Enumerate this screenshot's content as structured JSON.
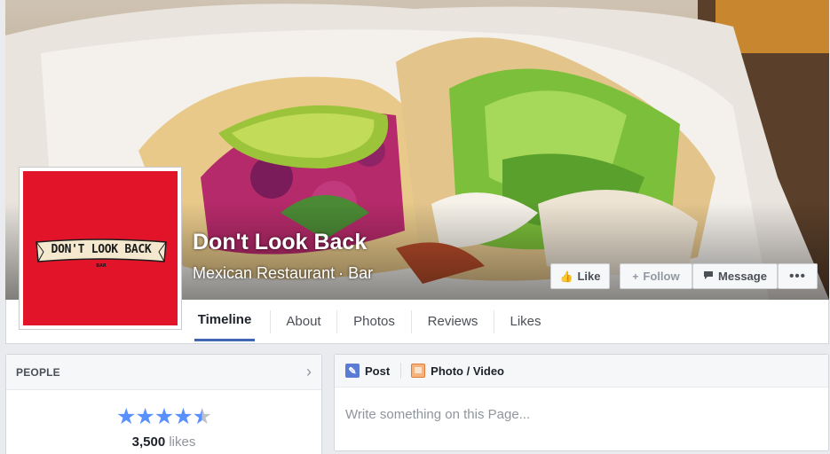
{
  "page": {
    "name": "Don't Look Back",
    "category": "Mexican Restaurant",
    "subcategory": "Bar",
    "category_separator": "·"
  },
  "profile_logo": {
    "text": "DON'T LOOK BACK",
    "sub_text": "BAR",
    "background_color": "#e2142a"
  },
  "actions": {
    "like_label": "Like",
    "follow_label": "Follow",
    "message_label": "Message",
    "more_label": "•••"
  },
  "nav": {
    "tabs": [
      {
        "label": "Timeline",
        "active": true
      },
      {
        "label": "About"
      },
      {
        "label": "Photos"
      },
      {
        "label": "Reviews"
      },
      {
        "label": "Likes"
      }
    ]
  },
  "people": {
    "title": "PEOPLE",
    "rating_stars": 4.5,
    "likes_count": "3,500",
    "likes_label": "likes"
  },
  "composer": {
    "post_label": "Post",
    "photo_video_label": "Photo / Video",
    "placeholder": "Write something on this Page..."
  },
  "colors": {
    "accent": "#4267b2",
    "star": "#5890ff"
  }
}
